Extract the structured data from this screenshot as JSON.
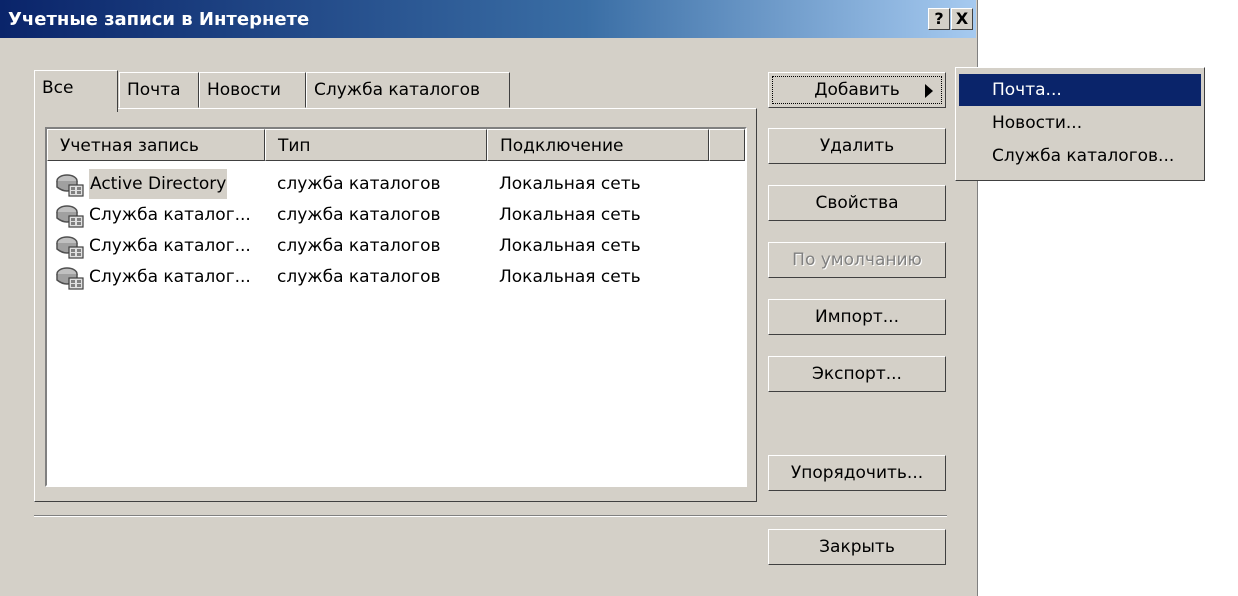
{
  "window": {
    "title": "Учетные записи в Интернете",
    "help_glyph": "?",
    "close_glyph": "X"
  },
  "tabs": [
    "Все",
    "Почта",
    "Новости",
    "Служба каталогов"
  ],
  "list": {
    "columns": [
      "Учетная запись",
      "Тип",
      "Подключение"
    ],
    "rows": [
      {
        "account": "Active Directory",
        "type": "служба каталогов",
        "connection": "Локальная сеть",
        "icon": "directory-service-icon",
        "selected": true
      },
      {
        "account": "Служба каталог...",
        "type": "служба каталогов",
        "connection": "Локальная сеть",
        "icon": "directory-service-icon"
      },
      {
        "account": "Служба каталог...",
        "type": "служба каталогов",
        "connection": "Локальная сеть",
        "icon": "directory-service-icon"
      },
      {
        "account": "Служба каталог...",
        "type": "служба каталогов",
        "connection": "Локальная сеть",
        "icon": "directory-service-icon"
      }
    ]
  },
  "buttons": {
    "add": "Добавить",
    "remove": "Удалить",
    "properties": "Свойства",
    "default": "По умолчанию",
    "import": "Импорт...",
    "export": "Экспорт...",
    "order": "Упорядочить...",
    "close": "Закрыть"
  },
  "add_menu": [
    "Почта...",
    "Новости...",
    "Служба каталогов..."
  ],
  "colors": {
    "face": "#d4d0c8",
    "title_active": "#0a246a",
    "highlight": "#0a246a"
  }
}
